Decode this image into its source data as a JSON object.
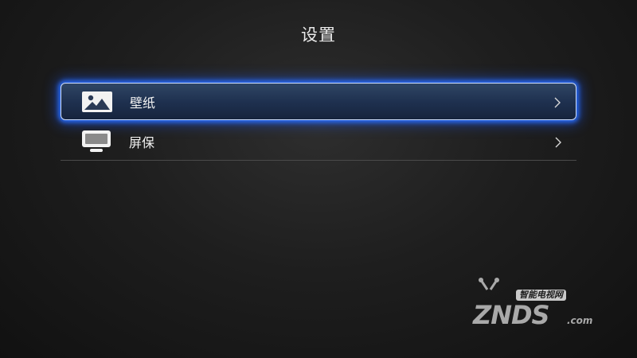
{
  "header": {
    "title": "设置"
  },
  "menu": {
    "items": [
      {
        "label": "壁纸",
        "icon": "image-icon",
        "selected": true
      },
      {
        "label": "屏保",
        "icon": "monitor-icon",
        "selected": false
      }
    ]
  },
  "watermark": {
    "tagline": "智能电视网",
    "brand": "ZNDS",
    "domain": ".com"
  },
  "colors": {
    "focus_glow": "#2a6cff",
    "focus_border": "#cfe0ff",
    "divider": "#4a4a4a"
  }
}
